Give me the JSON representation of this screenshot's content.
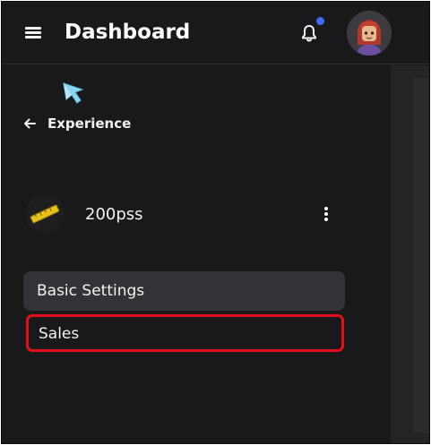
{
  "header": {
    "title": "Dashboard",
    "menu_icon": "hamburger-menu-icon",
    "notification_icon": "bell-icon",
    "notification_dot_color": "#3d6cf5",
    "avatar_icon": "user-avatar"
  },
  "sidebar": {
    "decoration_icon": "pointer-cursor-icon",
    "back_icon": "arrow-left-icon",
    "back_label": "Experience",
    "experience": {
      "name": "200pss",
      "thumbnail_icon": "experience-thumbnail",
      "more_icon": "kebab-menu-icon"
    },
    "items": [
      {
        "label": "Basic Settings",
        "selected": true
      },
      {
        "label": "Sales",
        "highlighted": true
      }
    ]
  },
  "colors": {
    "background": "#19191b",
    "selected_item": "#333337",
    "highlight_border": "#e3101a",
    "text": "#f2f2f2"
  }
}
